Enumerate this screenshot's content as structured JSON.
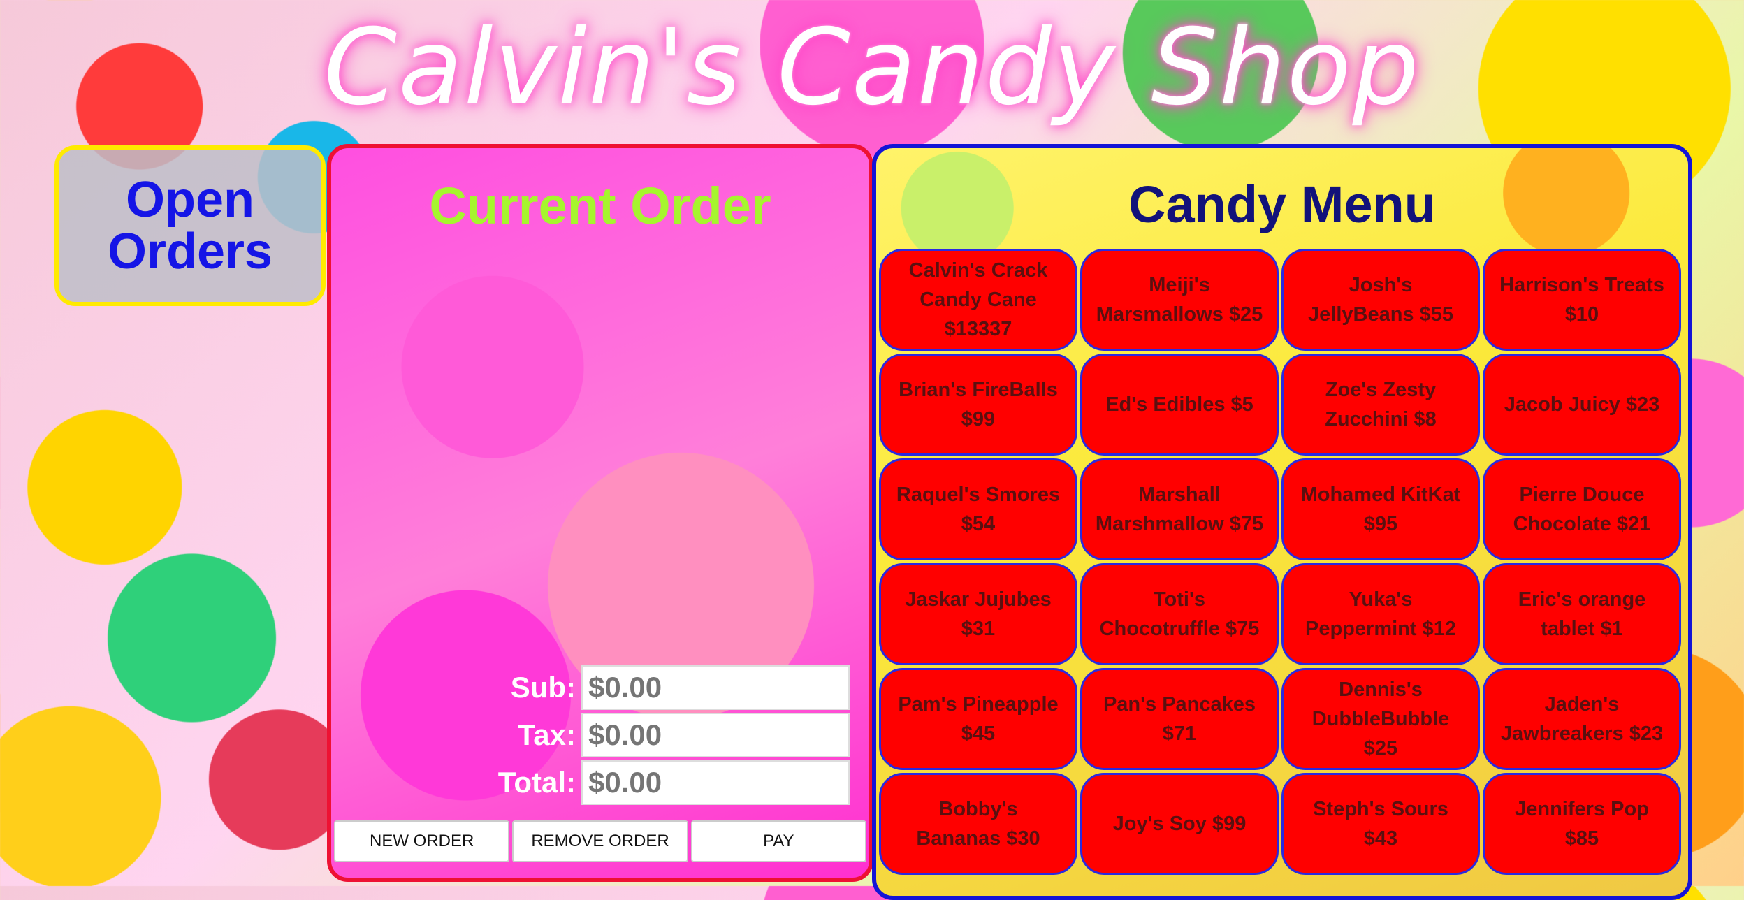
{
  "header": {
    "title": "Calvin's Candy Shop"
  },
  "sidebar": {
    "open_orders_label": "Open Orders"
  },
  "order": {
    "title": "Current Order",
    "sub_label": "Sub:",
    "tax_label": "Tax:",
    "total_label": "Total:",
    "sub_placeholder": "$0.00",
    "tax_placeholder": "$0.00",
    "total_placeholder": "$0.00",
    "new_order_label": "NEW ORDER",
    "remove_order_label": "REMOVE ORDER",
    "pay_label": "PAY"
  },
  "menu": {
    "title": "Candy Menu",
    "items": [
      "Calvin's Crack Candy Cane $13337",
      "Meiji's Marsmallows $25",
      "Josh's JellyBeans $55",
      "Harrison's Treats $10",
      "Brian's FireBalls $99",
      "Ed's Edibles $5",
      "Zoe's Zesty Zucchini $8",
      "Jacob Juicy $23",
      "Raquel's Smores $54",
      "Marshall Marshmallow $75",
      "Mohamed KitKat $95",
      "Pierre Douce Chocolate $21",
      "Jaskar Jujubes $31",
      "Toti's Chocotruffle $75",
      "Yuka's Peppermint $12",
      "Eric's orange tablet $1",
      "Pam's Pineapple $45",
      "Pan's Pancakes $71",
      "Dennis's DubbleBubble $25",
      "Jaden's Jawbreakers $23",
      "Bobby's Bananas $30",
      "Joy's Soy $99",
      "Steph's Sours $43",
      "Jennifers Pop $85"
    ]
  }
}
